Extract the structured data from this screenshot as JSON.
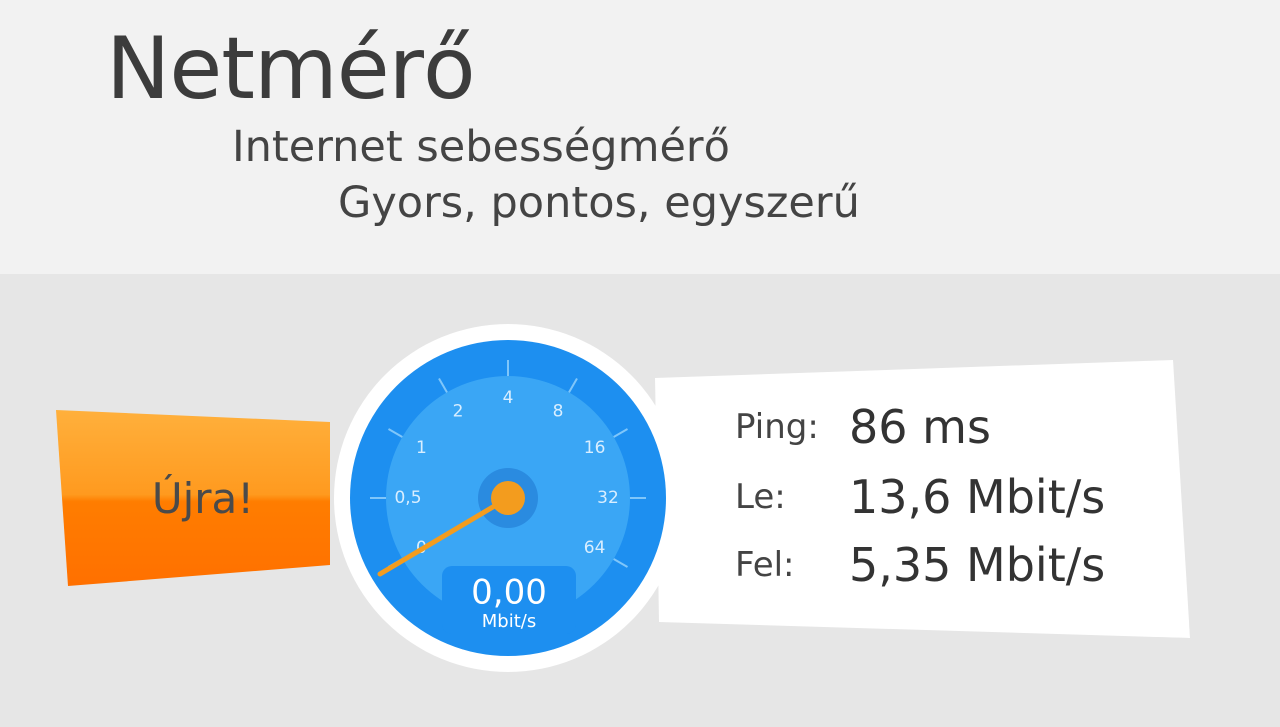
{
  "header": {
    "title": "Netmérő",
    "subtitle": "Internet sebességmérő",
    "tagline": "Gyors, pontos, egyszerű"
  },
  "retry_button": {
    "label": "Újra!"
  },
  "gauge": {
    "ticks": [
      "0",
      "0,5",
      "1",
      "2",
      "4",
      "8",
      "16",
      "32",
      "64"
    ],
    "current_value": "0,00",
    "unit": "Mbit/s",
    "colors": {
      "face": "#1d8ff0",
      "inner": "#3aa6f5",
      "needle": "#f39c1e"
    }
  },
  "results": {
    "ping_label": "Ping:",
    "ping_value": "86 ms",
    "download_label": "Le:",
    "download_value": "13,6 Mbit/s",
    "upload_label": "Fel:",
    "upload_value": "5,35 Mbit/s"
  }
}
